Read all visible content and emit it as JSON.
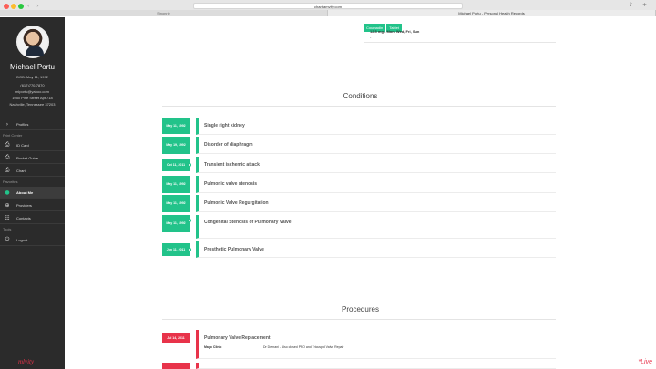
{
  "browser": {
    "url": "chart.amvity.com",
    "tabs": [
      "Sinonrie",
      "Michael Portu - Personal Health Records"
    ]
  },
  "sidebar": {
    "name": "Michael Portu",
    "dob": "DOB: May 11, 1992",
    "phone": "(612)770-7870",
    "email": "mlportu@yahoo.com",
    "address1": "1050 Pine Street Apt 718",
    "address2": "Nashville, Tennessee 37203",
    "items": [
      {
        "label": "Profiles",
        "icon": "chevron-right-icon"
      },
      {
        "label": "ID Card",
        "icon": "printer-icon"
      },
      {
        "label": "Pocket Guide",
        "icon": "printer-icon"
      },
      {
        "label": "Chart",
        "icon": "printer-icon"
      },
      {
        "label": "About Me",
        "icon": "person-icon"
      },
      {
        "label": "Providers",
        "icon": "plus-circle-icon"
      },
      {
        "label": "Contacts",
        "icon": "group-icon"
      },
      {
        "label": "Logout",
        "icon": "power-icon"
      }
    ],
    "sections": {
      "print": "Print Center",
      "favorites": "Favorites",
      "tools": "Tools"
    },
    "brand": "mlvity"
  },
  "medication": {
    "pills": [
      "Coumadin",
      "Tablet"
    ],
    "dosage": "12.5 mg - Mon, Wed, Fri, Sun",
    "dash": "-"
  },
  "conditions": {
    "title": "Conditions",
    "rows": [
      {
        "date": "May 11, 1992",
        "label": "Single right kidney"
      },
      {
        "date": "May 19, 1992",
        "label": "Disorder of diaphragm"
      },
      {
        "date": "Oct 11, 2011",
        "label": "Transient ischemic attack"
      },
      {
        "date": "May 11, 1992",
        "label": "Pulmonic valve stenosis"
      },
      {
        "date": "May 11, 1992",
        "label": "Pulmonic Valve Regurgitation"
      },
      {
        "date": "May 11, 1992",
        "label": "Congenital Stenosis of Pulmonary Valve"
      },
      {
        "date": "Jun 11, 2011",
        "label": "Prosthetic Pulmonary Valve"
      }
    ]
  },
  "procedures": {
    "title": "Procedures",
    "rows": [
      {
        "date": "Jul 14, 2011",
        "label": "Pulmonary Valve Replacement",
        "facility": "Mayo Clinic",
        "note": "Dr Dernani - Also closed PFO and Tricuspid Valve Repair"
      }
    ]
  },
  "live_badge": "*Live",
  "colors": {
    "accent": "#22c38a",
    "procedure": "#e8334a",
    "sidebar": "#2b2b2b"
  }
}
